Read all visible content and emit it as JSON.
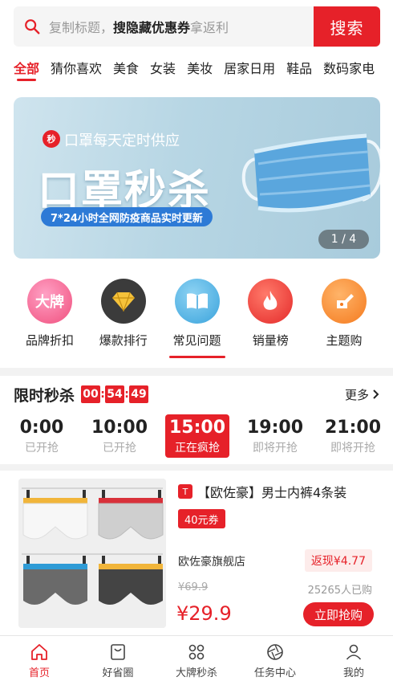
{
  "search": {
    "placeholder_prefix": "复制标题，",
    "placeholder_bold": "搜隐藏优惠券",
    "placeholder_suffix": "拿返利",
    "button_label": "搜索"
  },
  "categories": [
    "全部",
    "猜你喜欢",
    "美食",
    "女装",
    "美妆",
    "居家日用",
    "鞋品",
    "数码家电"
  ],
  "banner": {
    "badge": "秒",
    "subtitle": "口罩每天定时供应",
    "title": "口罩秒杀",
    "pill": "7*24小时全网防疫商品实时更新",
    "pager": "1 / 4"
  },
  "quick": [
    {
      "label": "品牌折扣",
      "icon": "brand-icon",
      "icon_text": "大牌"
    },
    {
      "label": "爆款排行",
      "icon": "diamond-icon"
    },
    {
      "label": "常见问题",
      "icon": "book-icon"
    },
    {
      "label": "销量榜",
      "icon": "flame-icon"
    },
    {
      "label": "主题购",
      "icon": "pump-icon"
    }
  ],
  "flash_sale": {
    "title": "限时秒杀",
    "timer": [
      "00",
      "54",
      "49"
    ],
    "more": "更多",
    "slots": [
      {
        "time": "0:00",
        "status": "已开抢"
      },
      {
        "time": "10:00",
        "status": "已开抢"
      },
      {
        "time": "15:00",
        "status": "正在疯抢"
      },
      {
        "time": "19:00",
        "status": "即将开抢"
      },
      {
        "time": "21:00",
        "status": "即将开抢"
      }
    ]
  },
  "product": {
    "tm_badge": "T",
    "title": "【欧佐豪】男士内裤4条装",
    "coupon": "40元券",
    "shop": "欧佐豪旗舰店",
    "rebate": "返现¥4.77",
    "original_price": "¥69.9",
    "sold": "25265人已购",
    "price": "¥29.9",
    "buy_label": "立即抢购"
  },
  "tabbar": [
    {
      "label": "首页",
      "icon": "home-icon"
    },
    {
      "label": "好省圈",
      "icon": "bag-icon"
    },
    {
      "label": "大牌秒杀",
      "icon": "grid-icon"
    },
    {
      "label": "任务中心",
      "icon": "aperture-icon"
    },
    {
      "label": "我的",
      "icon": "user-icon"
    }
  ],
  "colors": {
    "accent": "#e62129",
    "muted": "#aaaaaa"
  }
}
